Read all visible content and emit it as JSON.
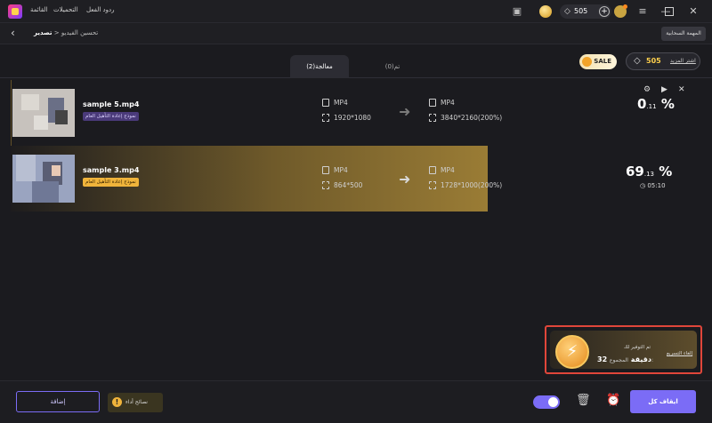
{
  "menu": {
    "items": [
      "القائمة",
      "التحميلات",
      "ردود الفعل"
    ]
  },
  "titlebar": {
    "gems": "505"
  },
  "breadcrumb": {
    "parent": "تحسين الفيديو",
    "separator": "<",
    "current": "تصدير"
  },
  "header": {
    "cloud_task": "المهمة السحابية"
  },
  "tabs": [
    {
      "label": "معالجة(2)"
    },
    {
      "label": "تم(0)"
    }
  ],
  "promo": {
    "gems": "505",
    "more_link": "اشتر المزيد",
    "sale": "SALE"
  },
  "rows": [
    {
      "filename": "sample 5.mp4",
      "tag": "نموذج إعادة التأهيل العام",
      "src_format": "MP4",
      "src_res": "1920*1080",
      "dst_format": "MP4",
      "dst_res": "3840*2160(200%)",
      "pct_main": "0",
      "pct_frac": ".11",
      "pct_sign": "%",
      "progress": 0.0011
    },
    {
      "filename": "sample 3.mp4",
      "tag": "نموذج إعادة التأهيل العام",
      "src_format": "MP4",
      "src_res": "864*500",
      "dst_format": "MP4",
      "dst_res": "1728*1000(200%)",
      "pct_main": "69",
      "pct_frac": ".13",
      "pct_sign": "%",
      "time_left": "05:10",
      "progress": 0.6913
    }
  ],
  "savings": {
    "label": "تم التوفير لك",
    "total_label": "المجموع:",
    "total_value": "32 دقيقة",
    "cancel": "إلغاء التسريع"
  },
  "bottom": {
    "add": "إضافة",
    "tips": "نصائح أداء",
    "stop_all": "ايقاف كل"
  },
  "colors": {
    "accent": "#7b6cf6",
    "gold": "#f0b43b",
    "highlight": "#e0463a"
  }
}
